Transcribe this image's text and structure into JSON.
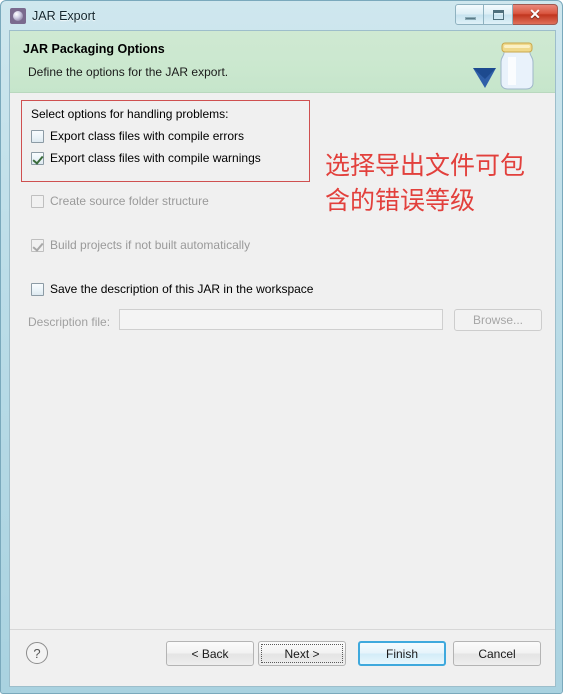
{
  "window": {
    "title": "JAR Export",
    "app_icon": "jar-export-icon",
    "controls": {
      "minimize": "Minimize",
      "maximize": "Maximize",
      "close": "Close",
      "close_glyph": "✕"
    }
  },
  "header": {
    "title": "JAR Packaging Options",
    "description": "Define the options for the JAR export.",
    "illustration": "jar-with-arrow-icon"
  },
  "options": {
    "group_label": "Select options for handling problems:",
    "items": [
      {
        "label": "Export class files with compile errors",
        "checked": false,
        "enabled": true,
        "name": "export-class-files-compile-errors"
      },
      {
        "label": "Export class files with compile warnings",
        "checked": true,
        "enabled": true,
        "name": "export-class-files-compile-warnings"
      },
      {
        "label": "Create source folder structure",
        "checked": false,
        "enabled": false,
        "name": "create-source-folder-structure"
      },
      {
        "label": "Build projects if not built automatically",
        "checked": true,
        "enabled": false,
        "name": "build-projects-if-not-built-automatically"
      },
      {
        "label": "Save the description of this JAR in the workspace",
        "checked": false,
        "enabled": true,
        "name": "save-description-in-workspace"
      }
    ]
  },
  "description_file": {
    "label": "Description file:",
    "value": "",
    "placeholder": "",
    "browse_label": "Browse...",
    "enabled": false
  },
  "annotation": {
    "line1": "选择导出文件可包",
    "line2": "含的错误等级",
    "color": "#e2403c",
    "highlight_box_color": "#cf5050"
  },
  "footer": {
    "help": "?",
    "buttons": [
      {
        "label": "< Back",
        "name": "back-button",
        "state": "enabled"
      },
      {
        "label": "Next >",
        "name": "next-button",
        "state": "focused-dotted"
      },
      {
        "label": "Finish",
        "name": "finish-button",
        "state": "default-focused"
      },
      {
        "label": "Cancel",
        "name": "cancel-button",
        "state": "enabled"
      }
    ]
  },
  "colors": {
    "header_green": "#cbe8cf",
    "window_chrome": "#bcdde8",
    "dialog_bg": "#f0f0f0",
    "focus_blue": "#3fa9dd",
    "close_red": "#c1361f"
  }
}
